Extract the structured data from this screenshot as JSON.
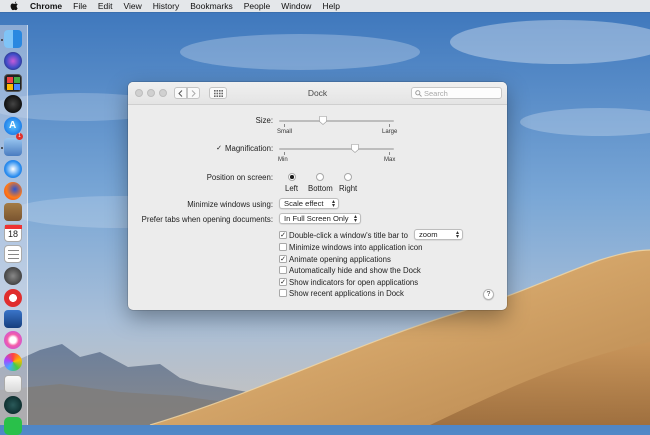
{
  "menubar": {
    "app": "Chrome",
    "items": [
      "File",
      "Edit",
      "View",
      "History",
      "Bookmarks",
      "People",
      "Window",
      "Help"
    ]
  },
  "dock": {
    "icons": [
      "finder-icon",
      "siri-icon",
      "photo-booth-icon",
      "dashboard-icon",
      "app-store-icon",
      "preview-icon",
      "safari-icon",
      "firefox-icon",
      "notes-icon",
      "calendar-icon",
      "reminders-icon",
      "launchpad-icon",
      "no-entry-icon",
      "ticket-icon",
      "itunes-icon",
      "photos-icon",
      "textedit-icon",
      "time-machine-icon",
      "messages-icon"
    ],
    "calendar_day": "18",
    "notification_badge": "1"
  },
  "window": {
    "title": "Dock",
    "search_placeholder": "Search",
    "size": {
      "label": "Size:",
      "min_label": "Small",
      "max_label": "Large",
      "value": 0.38
    },
    "magnification": {
      "label": "Magnification:",
      "checked": true,
      "min_label": "Min",
      "max_label": "Max",
      "value": 0.66
    },
    "position": {
      "label": "Position on screen:",
      "options": [
        "Left",
        "Bottom",
        "Right"
      ],
      "selected": "Left"
    },
    "minimize": {
      "label": "Minimize windows using:",
      "value": "Scale effect"
    },
    "prefer_tabs": {
      "label": "Prefer tabs when opening documents:",
      "value": "In Full Screen Only"
    },
    "double_click": {
      "label": "Double-click a window's title bar to",
      "value": "zoom",
      "checked": true
    },
    "options": [
      {
        "label": "Minimize windows into application icon",
        "checked": false
      },
      {
        "label": "Animate opening applications",
        "checked": true
      },
      {
        "label": "Automatically hide and show the Dock",
        "checked": false
      },
      {
        "label": "Show indicators for open applications",
        "checked": true
      },
      {
        "label": "Show recent applications in Dock",
        "checked": false
      }
    ],
    "help_glyph": "?"
  },
  "colors": {
    "window_bg": "#ececec",
    "desktop_sky": "#5f93cf",
    "dune": "#d6aa72"
  }
}
